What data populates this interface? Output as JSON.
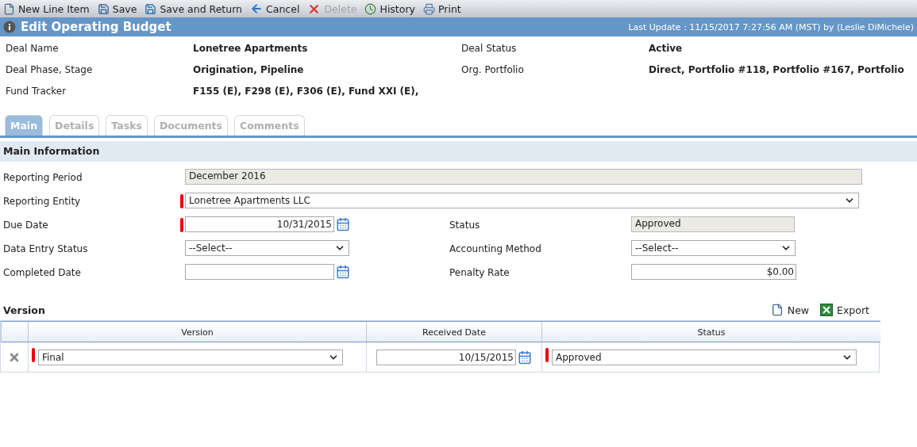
{
  "toolbar": [
    {
      "kind": "new",
      "label": "New Line Item",
      "disabled": false
    },
    {
      "kind": "save",
      "label": "Save",
      "disabled": false
    },
    {
      "kind": "save_return",
      "label": "Save and Return",
      "disabled": false
    },
    {
      "kind": "cancel",
      "label": "Cancel",
      "disabled": false
    },
    {
      "kind": "delete",
      "label": "Delete",
      "disabled": true
    },
    {
      "kind": "history",
      "label": "History",
      "disabled": false
    },
    {
      "kind": "print",
      "label": "Print",
      "disabled": false
    }
  ],
  "title": "Edit Operating Budget",
  "last_update": "Last Update : 11/15/2017 7:27:56 AM (MST) by (Leslie DiMichele)",
  "summary": [
    [
      {
        "label": "Deal Name",
        "value": "Lonetree Apartments"
      },
      {
        "label": "Deal Status",
        "value": "Active"
      }
    ],
    [
      {
        "label": "Deal Phase, Stage",
        "value": "Origination, Pipeline"
      },
      {
        "label": "Org. Portfolio",
        "value": "Direct, Portfolio #118, Portfolio #167, Portfolio"
      }
    ],
    [
      {
        "label": "Fund Tracker",
        "value": "F155 (E), F298 (E), F306 (E), Fund XXI (E),"
      }
    ]
  ],
  "tabs": [
    {
      "label": "Main",
      "selected": true
    },
    {
      "label": "Details",
      "selected": false
    },
    {
      "label": "Tasks",
      "selected": false
    },
    {
      "label": "Documents",
      "selected": false
    },
    {
      "label": "Comments",
      "selected": false
    }
  ],
  "section": "Main Information",
  "form": [
    [
      {
        "label": "Reporting Period",
        "kind": "readonly",
        "value": "December 2016",
        "required": false,
        "wide": true
      }
    ],
    [
      {
        "label": "Reporting Entity",
        "kind": "select",
        "value": "Lonetree Apartments LLC",
        "required": true,
        "wide": true
      }
    ],
    [
      {
        "label": "Due Date",
        "kind": "date",
        "value": "10/31/2015",
        "required": true
      },
      {
        "label": "Status",
        "kind": "readonly",
        "value": "Approved",
        "required": false
      }
    ],
    [
      {
        "label": "Data Entry Status",
        "kind": "select",
        "value": "--Select--",
        "required": false
      },
      {
        "label": "Accounting Method",
        "kind": "select",
        "value": "--Select--",
        "required": false
      }
    ],
    [
      {
        "label": "Completed Date",
        "kind": "date",
        "required": false
      },
      {
        "label": "Penalty Rate",
        "kind": "text",
        "value": "$0.00",
        "required": false
      }
    ]
  ],
  "version": {
    "title": "Version",
    "actions": [
      {
        "kind": "new",
        "label": "New"
      },
      {
        "kind": "export",
        "label": "Export"
      }
    ],
    "columns": [
      "Version",
      "Received Date",
      "Status"
    ],
    "rows": [
      {
        "version": "Final",
        "received_date": "10/15/2015",
        "status": "Approved"
      }
    ]
  }
}
